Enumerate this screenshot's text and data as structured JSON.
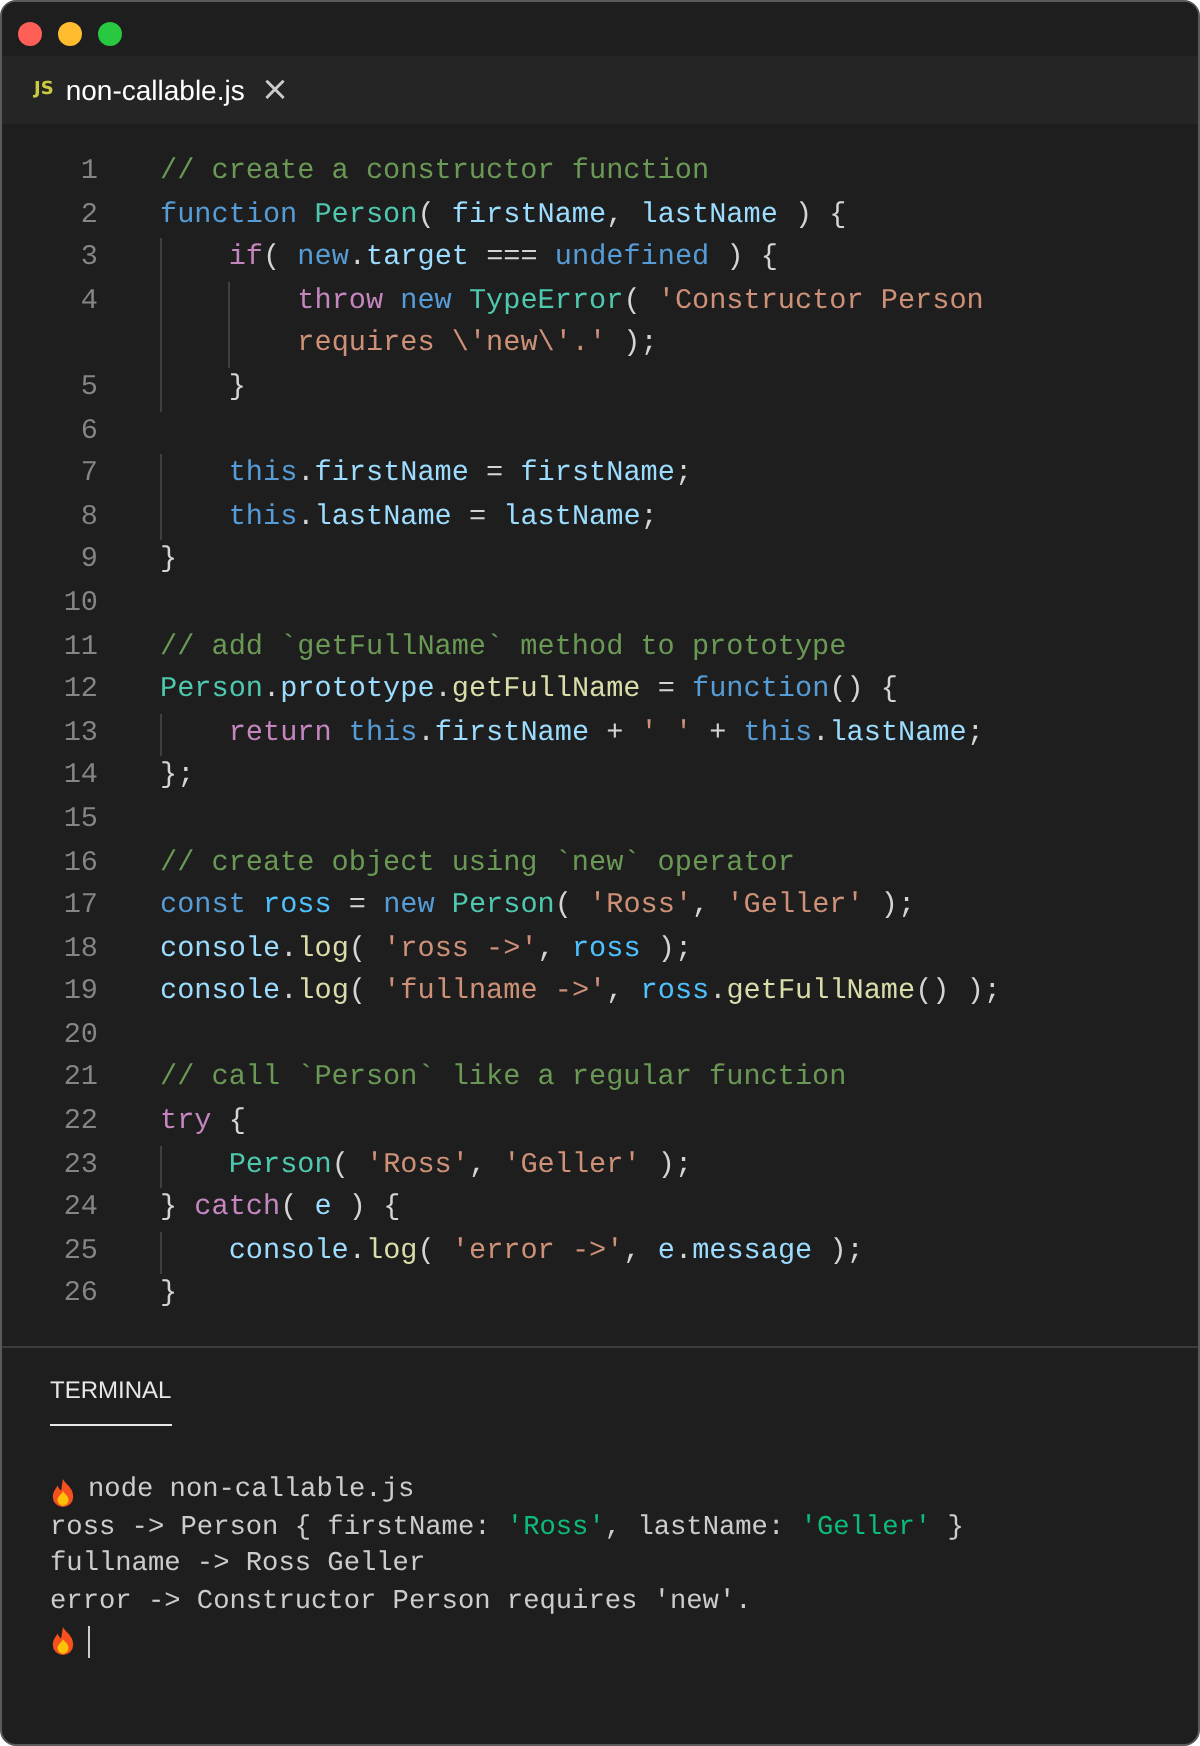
{
  "tab": {
    "badge": "JS",
    "title": "non-callable.js",
    "close": "×"
  },
  "code": [
    {
      "number": "1",
      "tokens": [
        {
          "kind": "comment",
          "text": "// create a constructor function"
        }
      ]
    },
    {
      "number": "2",
      "tokens": [
        {
          "kind": "storage",
          "text": "function "
        },
        {
          "kind": "type",
          "text": "Person"
        },
        {
          "kind": "plain",
          "text": "( "
        },
        {
          "kind": "variable",
          "text": "firstName"
        },
        {
          "kind": "plain",
          "text": ", "
        },
        {
          "kind": "variable",
          "text": "lastName"
        },
        {
          "kind": "plain",
          "text": " ) {"
        }
      ]
    },
    {
      "number": "3",
      "tokens": [
        {
          "kind": "control",
          "text": "    if"
        },
        {
          "kind": "plain",
          "text": "( "
        },
        {
          "kind": "storage",
          "text": "new"
        },
        {
          "kind": "plain",
          "text": "."
        },
        {
          "kind": "variable",
          "text": "target"
        },
        {
          "kind": "plain",
          "text": " === "
        },
        {
          "kind": "storage",
          "text": "undefined"
        },
        {
          "kind": "plain",
          "text": " ) {"
        }
      ]
    },
    {
      "number": "4",
      "tokens": [
        {
          "kind": "control",
          "text": "        throw "
        },
        {
          "kind": "storage",
          "text": "new "
        },
        {
          "kind": "type",
          "text": "TypeError"
        },
        {
          "kind": "plain",
          "text": "( "
        },
        {
          "kind": "string",
          "text": "'Constructor Person"
        }
      ]
    },
    {
      "tokens": [
        {
          "kind": "string",
          "text": "        requires \\'new\\'.'"
        },
        {
          "kind": "plain",
          "text": " );"
        }
      ]
    },
    {
      "number": "5",
      "tokens": [
        {
          "kind": "plain",
          "text": "    }"
        }
      ]
    },
    {
      "number": "6"
    },
    {
      "number": "7",
      "tokens": [
        {
          "kind": "storage",
          "text": "    this"
        },
        {
          "kind": "plain",
          "text": "."
        },
        {
          "kind": "variable",
          "text": "firstName"
        },
        {
          "kind": "plain",
          "text": " = "
        },
        {
          "kind": "variable",
          "text": "firstName"
        },
        {
          "kind": "plain",
          "text": ";"
        }
      ]
    },
    {
      "number": "8",
      "tokens": [
        {
          "kind": "storage",
          "text": "    this"
        },
        {
          "kind": "plain",
          "text": "."
        },
        {
          "kind": "variable",
          "text": "lastName"
        },
        {
          "kind": "plain",
          "text": " = "
        },
        {
          "kind": "variable",
          "text": "lastName"
        },
        {
          "kind": "plain",
          "text": ";"
        }
      ]
    },
    {
      "number": "9",
      "tokens": [
        {
          "kind": "plain",
          "text": "}"
        }
      ]
    },
    {
      "number": "10"
    },
    {
      "number": "11",
      "tokens": [
        {
          "kind": "comment",
          "text": "// add `getFullName` method to prototype"
        }
      ]
    },
    {
      "number": "12",
      "tokens": [
        {
          "kind": "type",
          "text": "Person"
        },
        {
          "kind": "plain",
          "text": "."
        },
        {
          "kind": "variable",
          "text": "prototype"
        },
        {
          "kind": "plain",
          "text": "."
        },
        {
          "kind": "function",
          "text": "getFullName"
        },
        {
          "kind": "plain",
          "text": " = "
        },
        {
          "kind": "storage",
          "text": "function"
        },
        {
          "kind": "plain",
          "text": "() {"
        }
      ]
    },
    {
      "number": "13",
      "tokens": [
        {
          "kind": "control",
          "text": "    return "
        },
        {
          "kind": "storage",
          "text": "this"
        },
        {
          "kind": "plain",
          "text": "."
        },
        {
          "kind": "variable",
          "text": "firstName"
        },
        {
          "kind": "plain",
          "text": " + "
        },
        {
          "kind": "string",
          "text": "' '"
        },
        {
          "kind": "plain",
          "text": " + "
        },
        {
          "kind": "storage",
          "text": "this"
        },
        {
          "kind": "plain",
          "text": "."
        },
        {
          "kind": "variable",
          "text": "lastName"
        },
        {
          "kind": "plain",
          "text": ";"
        }
      ]
    },
    {
      "number": "14",
      "tokens": [
        {
          "kind": "plain",
          "text": "};"
        }
      ]
    },
    {
      "number": "15"
    },
    {
      "number": "16",
      "tokens": [
        {
          "kind": "comment",
          "text": "// create object using `new` operator"
        }
      ]
    },
    {
      "number": "17",
      "tokens": [
        {
          "kind": "storage",
          "text": "const "
        },
        {
          "kind": "constant",
          "text": "ross"
        },
        {
          "kind": "plain",
          "text": " = "
        },
        {
          "kind": "storage",
          "text": "new "
        },
        {
          "kind": "type",
          "text": "Person"
        },
        {
          "kind": "plain",
          "text": "( "
        },
        {
          "kind": "string",
          "text": "'Ross'"
        },
        {
          "kind": "plain",
          "text": ", "
        },
        {
          "kind": "string",
          "text": "'Geller'"
        },
        {
          "kind": "plain",
          "text": " );"
        }
      ]
    },
    {
      "number": "18",
      "tokens": [
        {
          "kind": "variable",
          "text": "console"
        },
        {
          "kind": "plain",
          "text": "."
        },
        {
          "kind": "function",
          "text": "log"
        },
        {
          "kind": "plain",
          "text": "( "
        },
        {
          "kind": "string",
          "text": "'ross ->'"
        },
        {
          "kind": "plain",
          "text": ", "
        },
        {
          "kind": "constant",
          "text": "ross"
        },
        {
          "kind": "plain",
          "text": " );"
        }
      ]
    },
    {
      "number": "19",
      "tokens": [
        {
          "kind": "variable",
          "text": "console"
        },
        {
          "kind": "plain",
          "text": "."
        },
        {
          "kind": "function",
          "text": "log"
        },
        {
          "kind": "plain",
          "text": "( "
        },
        {
          "kind": "string",
          "text": "'fullname ->'"
        },
        {
          "kind": "plain",
          "text": ", "
        },
        {
          "kind": "constant",
          "text": "ross"
        },
        {
          "kind": "plain",
          "text": "."
        },
        {
          "kind": "function",
          "text": "getFullName"
        },
        {
          "kind": "plain",
          "text": "() );"
        }
      ]
    },
    {
      "number": "20"
    },
    {
      "number": "21",
      "tokens": [
        {
          "kind": "comment",
          "text": "// call `Person` like a regular function"
        }
      ]
    },
    {
      "number": "22",
      "tokens": [
        {
          "kind": "control",
          "text": "try"
        },
        {
          "kind": "plain",
          "text": " {"
        }
      ]
    },
    {
      "number": "23",
      "tokens": [
        {
          "kind": "type",
          "text": "    Person"
        },
        {
          "kind": "plain",
          "text": "( "
        },
        {
          "kind": "string",
          "text": "'Ross'"
        },
        {
          "kind": "plain",
          "text": ", "
        },
        {
          "kind": "string",
          "text": "'Geller'"
        },
        {
          "kind": "plain",
          "text": " );"
        }
      ]
    },
    {
      "number": "24",
      "tokens": [
        {
          "kind": "plain",
          "text": "} "
        },
        {
          "kind": "control",
          "text": "catch"
        },
        {
          "kind": "plain",
          "text": "( "
        },
        {
          "kind": "variable",
          "text": "e"
        },
        {
          "kind": "plain",
          "text": " ) {"
        }
      ]
    },
    {
      "number": "25",
      "tokens": [
        {
          "kind": "variable",
          "text": "    console"
        },
        {
          "kind": "plain",
          "text": "."
        },
        {
          "kind": "function",
          "text": "log"
        },
        {
          "kind": "plain",
          "text": "( "
        },
        {
          "kind": "string",
          "text": "'error ->'"
        },
        {
          "kind": "plain",
          "text": ", "
        },
        {
          "kind": "variable",
          "text": "e"
        },
        {
          "kind": "plain",
          "text": "."
        },
        {
          "kind": "variable",
          "text": "message"
        },
        {
          "kind": "plain",
          "text": " );"
        }
      ]
    },
    {
      "number": "26",
      "tokens": [
        {
          "kind": "plain",
          "text": "}"
        }
      ]
    }
  ],
  "panel": {
    "tab": "TERMINAL",
    "selected": true
  },
  "terminal": [
    {
      "kind": "command",
      "tokens": [
        {
          "kind": "plain",
          "text": "node non-callable.js"
        }
      ]
    },
    {
      "kind": "output",
      "tokens": [
        {
          "kind": "plain",
          "text": "ross -> Person { firstName: "
        },
        {
          "kind": "string",
          "text": "'Ross'"
        },
        {
          "kind": "plain",
          "text": ", lastName: "
        },
        {
          "kind": "string",
          "text": "'Geller'"
        },
        {
          "kind": "plain",
          "text": " }"
        }
      ]
    },
    {
      "kind": "output",
      "tokens": [
        {
          "kind": "plain",
          "text": "fullname -> Ross Geller"
        }
      ]
    },
    {
      "kind": "output",
      "tokens": [
        {
          "kind": "plain",
          "text": "error -> Constructor Person requires 'new'."
        }
      ]
    },
    {
      "kind": "prompt"
    }
  ]
}
